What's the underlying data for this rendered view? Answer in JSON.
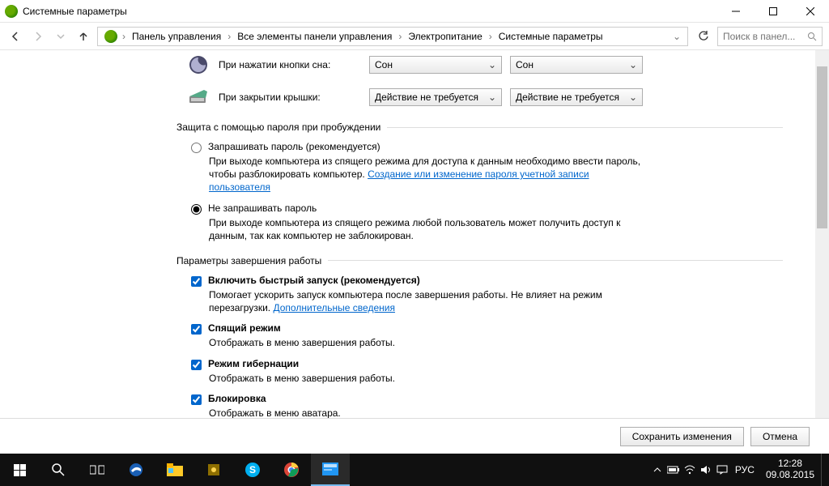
{
  "window": {
    "title": "Системные параметры"
  },
  "breadcrumb": {
    "items": [
      "Панель управления",
      "Все элементы панели управления",
      "Электропитание",
      "Системные параметры"
    ]
  },
  "search": {
    "placeholder": "Поиск в панел..."
  },
  "settings": {
    "sleep_button": {
      "label": "При нажатии кнопки сна:",
      "col1": "Сон",
      "col2": "Сон"
    },
    "lid_close": {
      "label": "При закрытии крышки:",
      "col1": "Действие не требуется",
      "col2": "Действие не требуется"
    }
  },
  "section_password": {
    "title": "Защита с помощью пароля при пробуждении",
    "opt_require": {
      "label": "Запрашивать пароль (рекомендуется)",
      "desc_before": "При выходе компьютера из спящего режима для доступа к данным необходимо ввести пароль, чтобы разблокировать компьютер. ",
      "link": "Создание или изменение пароля учетной записи пользователя"
    },
    "opt_norequire": {
      "label": "Не запрашивать пароль",
      "desc": "При выходе компьютера из спящего режима любой пользователь может получить доступ к данным, так как компьютер не заблокирован."
    }
  },
  "section_shutdown": {
    "title": "Параметры завершения работы",
    "fast": {
      "label": "Включить быстрый запуск (рекомендуется)",
      "desc_before": "Помогает ускорить запуск компьютера после завершения работы. Не влияет на режим перезагрузки. ",
      "link": "Дополнительные сведения"
    },
    "sleep": {
      "label": "Спящий режим",
      "desc": "Отображать в меню завершения работы."
    },
    "hibernate": {
      "label": "Режим гибернации",
      "desc": "Отображать в меню завершения работы."
    },
    "lock": {
      "label": "Блокировка",
      "desc": "Отображать в меню аватара."
    }
  },
  "footer": {
    "save": "Сохранить изменения",
    "cancel": "Отмена"
  },
  "taskbar": {
    "lang": "РУС",
    "time": "12:28",
    "date": "09.08.2015"
  }
}
